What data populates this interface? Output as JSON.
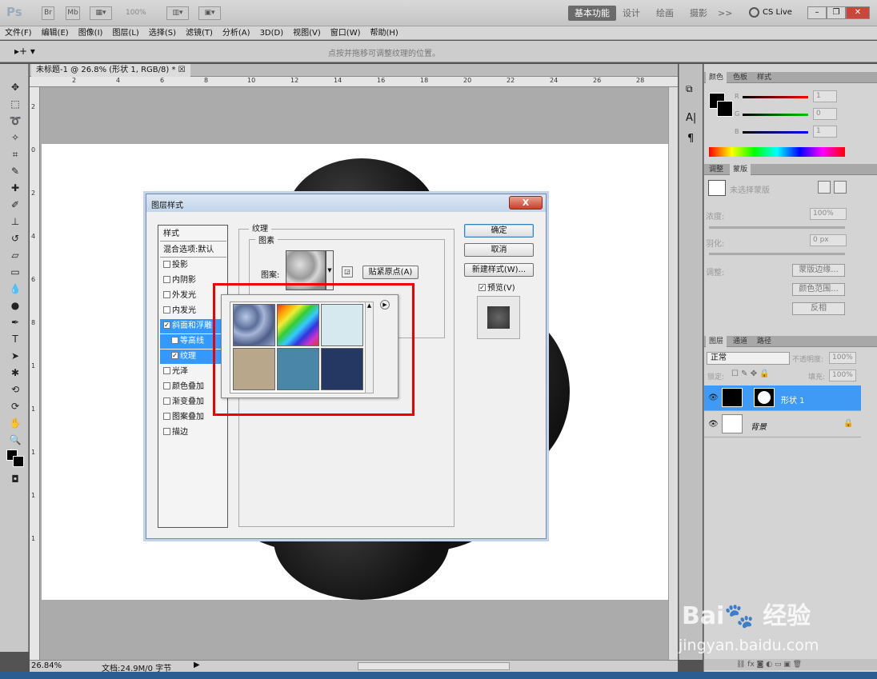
{
  "app": {
    "logo": "Ps",
    "bridge": "Br",
    "minibridge": "Mb",
    "zoom_preset": "100%",
    "workspaces": [
      "基本功能",
      "设计",
      "绘画",
      "摄影"
    ],
    "active_workspace": "基本功能",
    "more_workspaces": ">>",
    "cslive": "CS Live"
  },
  "menu": [
    "文件(F)",
    "编辑(E)",
    "图像(I)",
    "图层(L)",
    "选择(S)",
    "滤镜(T)",
    "分析(A)",
    "3D(D)",
    "视图(V)",
    "窗口(W)",
    "帮助(H)"
  ],
  "options_bar": {
    "hint": "点按并拖移可调整纹理的位置。"
  },
  "document": {
    "tab_title": "未标题-1 @ 26.8% (形状 1, RGB/8) *",
    "ruler_h": [
      "2",
      "4",
      "6",
      "8",
      "10",
      "12",
      "14",
      "16",
      "18",
      "20",
      "22",
      "24",
      "26",
      "28"
    ],
    "ruler_v": [
      "2",
      "0",
      "2",
      "4",
      "6",
      "8",
      "1",
      "1",
      "1",
      "1",
      "1"
    ]
  },
  "status": {
    "zoom": "26.84%",
    "doc_info": "文档:24.9M/0 字节"
  },
  "dialog": {
    "title": "图层样式",
    "close": "X",
    "styles_header": "样式",
    "blend_options": "混合选项:默认",
    "items": [
      {
        "label": "投影",
        "checked": false,
        "selected": false,
        "indent": false
      },
      {
        "label": "内阴影",
        "checked": false,
        "selected": false,
        "indent": false
      },
      {
        "label": "外发光",
        "checked": false,
        "selected": false,
        "indent": false
      },
      {
        "label": "内发光",
        "checked": false,
        "selected": false,
        "indent": false
      },
      {
        "label": "斜面和浮雕",
        "checked": true,
        "selected": true,
        "indent": false
      },
      {
        "label": "等高线",
        "checked": false,
        "selected": true,
        "indent": true
      },
      {
        "label": "纹理",
        "checked": true,
        "selected": true,
        "indent": true
      },
      {
        "label": "光泽",
        "checked": false,
        "selected": false,
        "indent": false
      },
      {
        "label": "颜色叠加",
        "checked": false,
        "selected": false,
        "indent": false
      },
      {
        "label": "渐变叠加",
        "checked": false,
        "selected": false,
        "indent": false
      },
      {
        "label": "图案叠加",
        "checked": false,
        "selected": false,
        "indent": false
      },
      {
        "label": "描边",
        "checked": false,
        "selected": false,
        "indent": false
      }
    ],
    "texture_group": "纹理",
    "pattern_group": "图素",
    "pattern_label": "图案:",
    "snap_origin": "贴紧原点(A)",
    "ok": "确定",
    "cancel": "取消",
    "new_style": "新建样式(W)...",
    "preview": "预览(V)",
    "preview_checked": true
  },
  "pattern_picker": {
    "swatch_names": [
      "bubbles",
      "rainbow",
      "light-blue",
      "tan-sand",
      "blue-texture",
      "navy-denim"
    ]
  },
  "color_panel": {
    "tabs": [
      "颜色",
      "色板",
      "样式"
    ],
    "r_label": "R",
    "g_label": "G",
    "b_label": "B",
    "r": "1",
    "g": "0",
    "b": "1"
  },
  "masks_panel": {
    "tabs": [
      "调整",
      "蒙版"
    ],
    "no_mask": "未选择蒙版",
    "density_label": "浓度:",
    "density": "100%",
    "feather_label": "羽化:",
    "feather": "0 px",
    "refine_label": "调整:",
    "mask_edge": "蒙版边缘...",
    "color_range": "颜色范围...",
    "invert": "反相"
  },
  "layers_panel": {
    "tabs": [
      "图层",
      "通道",
      "路径"
    ],
    "blend_mode": "正常",
    "opacity_label": "不透明度:",
    "opacity": "100%",
    "lock_label": "锁定:",
    "fill_label": "填充:",
    "fill": "100%",
    "layers": [
      {
        "name": "形状 1",
        "selected": true
      },
      {
        "name": "背景",
        "selected": false
      }
    ]
  },
  "watermark": {
    "text": "jingyan.baidu.com"
  }
}
